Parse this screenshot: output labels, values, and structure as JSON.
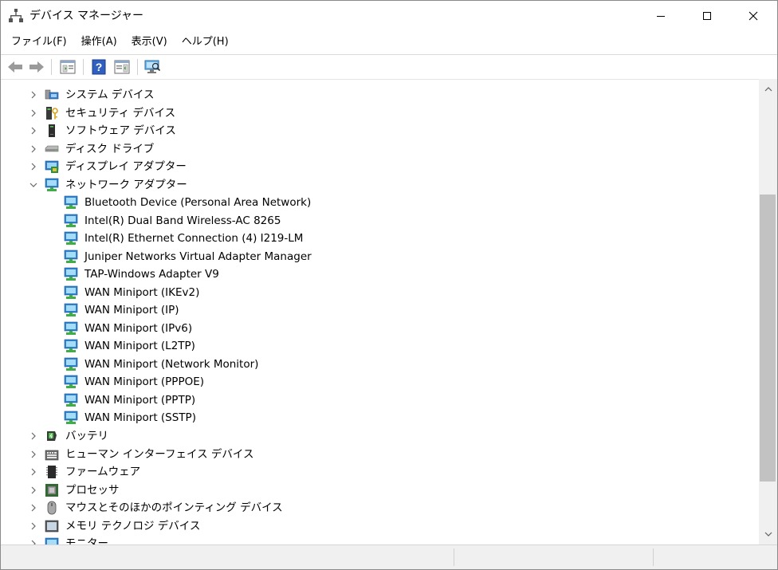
{
  "window": {
    "title": "デバイス マネージャー"
  },
  "menu": [
    {
      "label": "ファイル(F)"
    },
    {
      "label": "操作(A)"
    },
    {
      "label": "表示(V)"
    },
    {
      "label": "ヘルプ(H)"
    }
  ],
  "toolbar": {
    "buttons": [
      "back-arrow-icon",
      "forward-arrow-icon",
      "properties-panel-icon",
      "help-icon",
      "action-pane-icon",
      "scan-hardware-icon"
    ]
  },
  "tree": [
    {
      "label": "システム デバイス",
      "icon": "system-devices-icon",
      "expanded": false
    },
    {
      "label": "セキュリティ デバイス",
      "icon": "security-devices-icon",
      "expanded": false
    },
    {
      "label": "ソフトウェア デバイス",
      "icon": "software-devices-icon",
      "expanded": false
    },
    {
      "label": "ディスク ドライブ",
      "icon": "disk-drive-icon",
      "expanded": false
    },
    {
      "label": "ディスプレイ アダプター",
      "icon": "display-adapter-icon",
      "expanded": false
    },
    {
      "label": "ネットワーク アダプター",
      "icon": "network-adapter-icon",
      "expanded": true,
      "children": [
        "Bluetooth Device (Personal Area Network)",
        "Intel(R) Dual Band Wireless-AC 8265",
        "Intel(R) Ethernet Connection (4) I219-LM",
        "Juniper Networks Virtual Adapter Manager",
        "TAP-Windows Adapter V9",
        "WAN Miniport (IKEv2)",
        "WAN Miniport (IP)",
        "WAN Miniport (IPv6)",
        "WAN Miniport (L2TP)",
        "WAN Miniport (Network Monitor)",
        "WAN Miniport (PPPOE)",
        "WAN Miniport (PPTP)",
        "WAN Miniport (SSTP)"
      ]
    },
    {
      "label": "バッテリ",
      "icon": "battery-icon",
      "expanded": false
    },
    {
      "label": "ヒューマン インターフェイス デバイス",
      "icon": "hid-keyboard-icon",
      "expanded": false
    },
    {
      "label": "ファームウェア",
      "icon": "firmware-chip-icon",
      "expanded": false
    },
    {
      "label": "プロセッサ",
      "icon": "processor-icon",
      "expanded": false
    },
    {
      "label": "マウスとそのほかのポインティング デバイス",
      "icon": "mouse-icon",
      "expanded": false
    },
    {
      "label": "メモリ テクノロジ デバイス",
      "icon": "memory-technology-icon",
      "expanded": false
    },
    {
      "label": "モニター",
      "icon": "monitor-icon",
      "expanded": false
    }
  ],
  "colors": {
    "accent_blue": "#1f6fd1",
    "monitor_green": "#3fae49",
    "chevron": "#666666"
  }
}
